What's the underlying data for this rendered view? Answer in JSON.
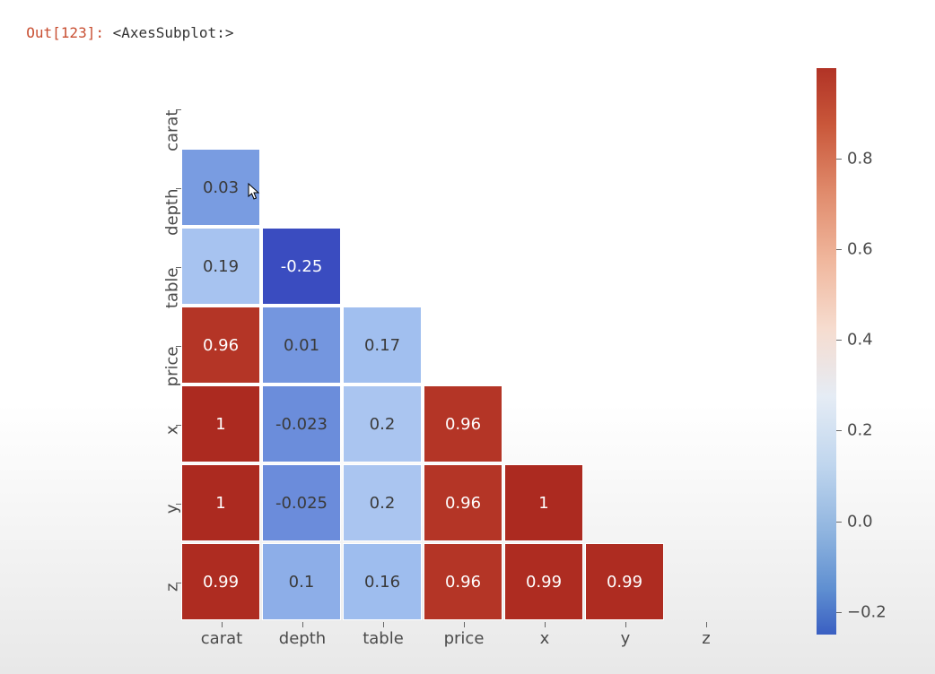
{
  "output_prompt": "Out[123]: ",
  "output_value": "<AxesSubplot:>",
  "chart_data": {
    "type": "heatmap",
    "labels": [
      "carat",
      "depth",
      "table",
      "price",
      "x",
      "y",
      "z"
    ],
    "matrix": [
      [
        null,
        null,
        null,
        null,
        null,
        null,
        null
      ],
      [
        0.03,
        null,
        null,
        null,
        null,
        null,
        null
      ],
      [
        0.19,
        -0.25,
        null,
        null,
        null,
        null,
        null
      ],
      [
        0.96,
        0.01,
        0.17,
        null,
        null,
        null,
        null
      ],
      [
        1,
        -0.023,
        0.2,
        0.96,
        null,
        null,
        null
      ],
      [
        1,
        -0.025,
        0.2,
        0.96,
        1,
        null,
        null
      ],
      [
        0.99,
        0.1,
        0.16,
        0.96,
        0.99,
        0.99,
        null
      ]
    ],
    "display": [
      [
        "",
        "",
        "",
        "",
        "",
        "",
        ""
      ],
      [
        "0.03",
        "",
        "",
        "",
        "",
        "",
        ""
      ],
      [
        "0.19",
        "-0.25",
        "",
        "",
        "",
        "",
        ""
      ],
      [
        "0.96",
        "0.01",
        "0.17",
        "",
        "",
        "",
        ""
      ],
      [
        "1",
        "-0.023",
        "0.2",
        "0.96",
        "",
        "",
        ""
      ],
      [
        "1",
        "-0.025",
        "0.2",
        "0.96",
        "1",
        "",
        ""
      ],
      [
        "0.99",
        "0.1",
        "0.16",
        "0.96",
        "0.99",
        "0.99",
        ""
      ]
    ],
    "colorbar": {
      "vmin": -0.25,
      "vmax": 1.0,
      "ticks": [
        -0.2,
        0.0,
        0.2,
        0.4,
        0.6,
        0.8
      ],
      "tick_labels": [
        "−0.2",
        "0.0",
        "0.2",
        "0.4",
        "0.6",
        "0.8"
      ],
      "cmap": "coolwarm"
    }
  }
}
